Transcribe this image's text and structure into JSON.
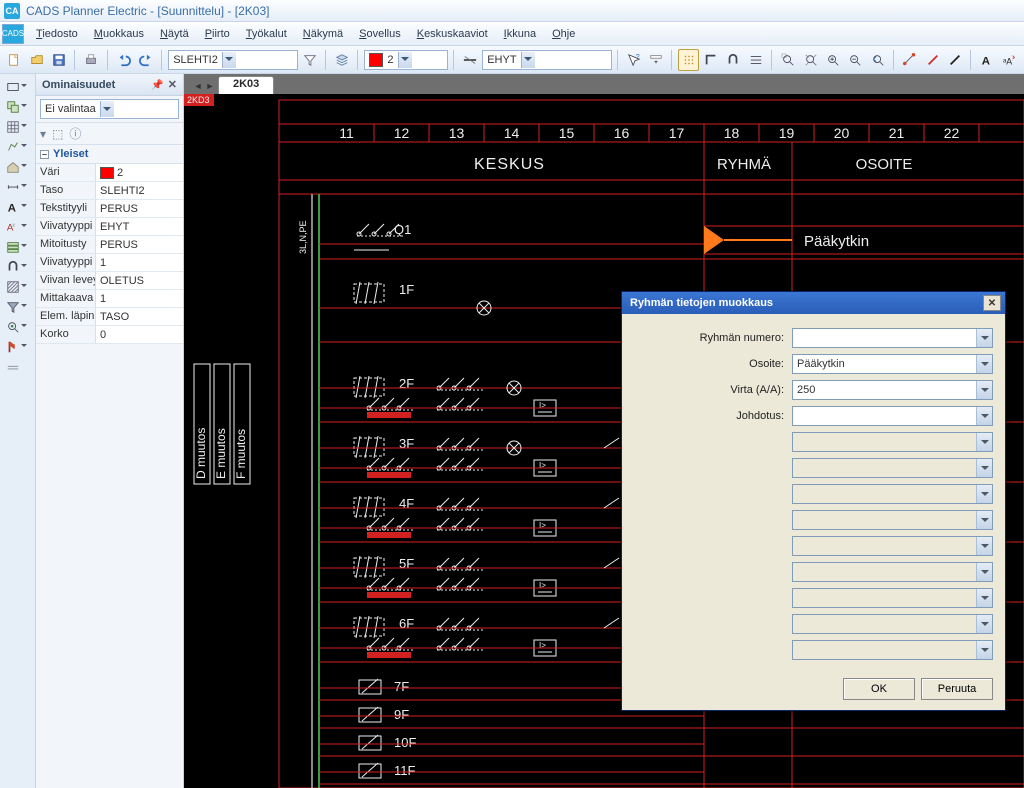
{
  "app": {
    "title": "CADS Planner Electric - [Suunnittelu] - [2K03]"
  },
  "menu": [
    "Tiedosto",
    "Muokkaus",
    "Näytä",
    "Piirto",
    "Työkalut",
    "Näkymä",
    "Sovellus",
    "Keskuskaaviot",
    "Ikkuna",
    "Ohje"
  ],
  "toolbar": {
    "layer": "SLEHTI2",
    "color_label": "2",
    "linetype": "EHYT"
  },
  "panel": {
    "title": "Ominaisuudet",
    "selection": "Ei valintaa",
    "group": "Yleiset",
    "rows": [
      {
        "k": "Väri",
        "v": "2",
        "color": true
      },
      {
        "k": "Taso",
        "v": "SLEHTI2"
      },
      {
        "k": "Tekstityyli",
        "v": "PERUS"
      },
      {
        "k": "Viivatyyppi",
        "v": "EHYT"
      },
      {
        "k": "Mitoitusty",
        "v": "PERUS"
      },
      {
        "k": "Viivatyyppi",
        "v": "1"
      },
      {
        "k": "Viivan leveys",
        "v": "OLETUS"
      },
      {
        "k": "Mittakaava",
        "v": "1"
      },
      {
        "k": "Elem. läpin",
        "v": "TASO"
      },
      {
        "k": "Korko",
        "v": "0"
      }
    ]
  },
  "drawing": {
    "tab": "2K03",
    "frame_label": "2KD3",
    "cols": [
      "11",
      "12",
      "13",
      "14",
      "15",
      "16",
      "17",
      "18",
      "19",
      "20",
      "21",
      "22"
    ],
    "header_keskus": "KESKUS",
    "header_ryhma": "RYHMÄ",
    "header_osoite": "OSOITE",
    "paakytkin": "Pääkytkin",
    "vbars": [
      "D muutos",
      "E muutos",
      "F muutos"
    ],
    "wire_label": "3L,N,PE",
    "circuits": [
      "Q1",
      "1F",
      "2F",
      "3F",
      "4F",
      "5F",
      "6F",
      "7F",
      "9F",
      "10F",
      "11F"
    ]
  },
  "dialog": {
    "title": "Ryhmän tietojen muokkaus",
    "fields": {
      "numero_lbl": "Ryhmän numero:",
      "numero": "",
      "osoite_lbl": "Osoite:",
      "osoite": "Pääkytkin",
      "virta_lbl": "Virta (A/A):",
      "virta": "250",
      "johdotus_lbl": "Johdotus:",
      "johdotus": ""
    },
    "ok": "OK",
    "cancel": "Peruuta"
  }
}
